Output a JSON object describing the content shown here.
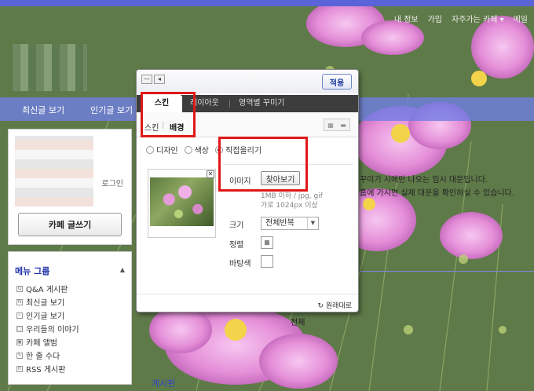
{
  "gnb": [
    "내 정보",
    "가입",
    "자주가는 카페 ▾",
    "메일"
  ],
  "cafe_menu": {
    "tab1": "최신글 보기",
    "tab2": "인기글 보기"
  },
  "sidebar": {
    "login_link": "로그인",
    "write_button": "카페 글쓰기",
    "menu_group_title": "메뉴 그룹",
    "menu_items": [
      {
        "icon": "Q",
        "label": "Q&A 게시판"
      },
      {
        "icon": "N",
        "label": "최신글 보기"
      },
      {
        "icon": "☆",
        "label": "인기글 보기"
      },
      {
        "icon": "□",
        "label": "우리들의 이야기"
      },
      {
        "icon": "▣",
        "label": "카페 앨범"
      },
      {
        "icon": "✎",
        "label": "한 줄 수다"
      },
      {
        "icon": "R",
        "label": "RSS 게시판"
      }
    ]
  },
  "background_texts": {
    "line1": "꾸미기 시에만 나오는 임시 대문입니다.",
    "line2": "홈에 가시면 실제 대문을 확인하실 수 있습니다.",
    "below_dialog": "전체",
    "board": "게시판"
  },
  "dialog": {
    "apply": "적용",
    "tabs": [
      "스킨",
      "레이아웃",
      "영역별 꾸미기"
    ],
    "subtabs": [
      "스킨",
      "배경"
    ],
    "radios": [
      "디자인",
      "색상",
      "직접올리기"
    ],
    "selected_radio": "직접올리기",
    "image_label": "이미지",
    "browse_button": "찾아보기",
    "hint1": "1MB 이하 / jpg, gif",
    "hint2": "가로 1024px 이상",
    "size_label": "크기",
    "size_value": "전체반복",
    "align_label": "정렬",
    "bgcolor_label": "바탕색",
    "restore": "원래대로"
  }
}
